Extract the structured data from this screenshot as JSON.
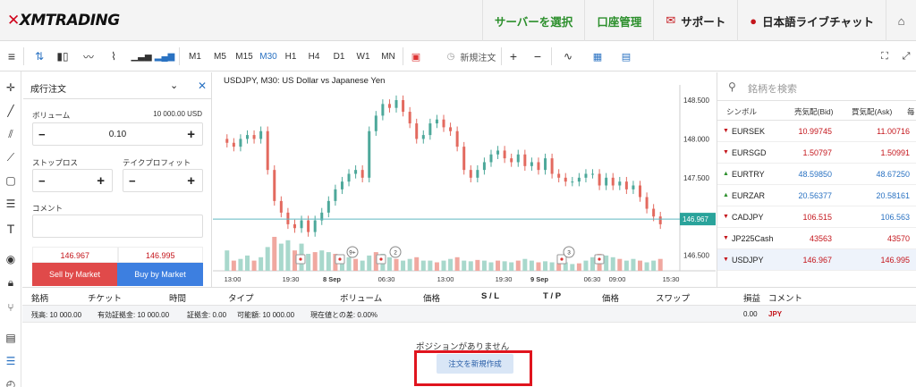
{
  "brand": {
    "logo_text": "XMTRADING",
    "accent": "#c4161c",
    "green": "#2c8f2c",
    "blue": "#2a72c2"
  },
  "topnav": {
    "server_select": "サーバーを選択",
    "account": "口座管理",
    "support": "サポート",
    "live_chat": "日本語ライブチャット"
  },
  "toolbar": {
    "timeframes": [
      "M1",
      "M5",
      "M15",
      "M30",
      "H1",
      "H4",
      "D1",
      "W1",
      "MN"
    ],
    "active_timeframe": "M30",
    "new_order": "新規注文"
  },
  "order_panel": {
    "order_type": "成行注文",
    "volume_label": "ボリューム",
    "volume_hint": "10 000.00 USD",
    "volume_value": "0.10",
    "stoploss_label": "ストップロス",
    "takeprofit_label": "テイクプロフィット",
    "comment_label": "コメント",
    "sell_price": "146.967",
    "buy_price": "146.995",
    "sell_button": "Sell by Market",
    "buy_button": "Buy by Market"
  },
  "chart": {
    "title": "USDJPY, M30: US Dollar vs Japanese Yen",
    "current_price": "146.967"
  },
  "chart_data": {
    "type": "candlestick",
    "title": "USDJPY, M30: US Dollar vs Japanese Yen",
    "y_ticks": [
      "148.500",
      "148.000",
      "147.500",
      "146.500"
    ],
    "x_ticks": [
      "13:00",
      "19:30",
      "8 Sep",
      "06:30",
      "13:00",
      "19:30",
      "9 Sep",
      "06:30",
      "09:00",
      "15:30"
    ],
    "current_price": 146.967,
    "badges": [
      "9+",
      "2",
      "3"
    ],
    "ylim": [
      146.3,
      148.65
    ],
    "close": [
      147.95,
      147.9,
      148.0,
      148.05,
      148.0,
      148.1,
      147.6,
      147.2,
      147.05,
      146.9,
      146.85,
      146.95,
      146.8,
      146.95,
      147.05,
      147.2,
      147.35,
      147.45,
      147.55,
      147.6,
      147.5,
      148.1,
      148.3,
      148.45,
      148.4,
      148.5,
      148.35,
      148.2,
      148.0,
      148.05,
      148.2,
      148.25,
      148.15,
      148.1,
      147.9,
      147.6,
      147.5,
      147.6,
      147.7,
      147.8,
      147.85,
      147.75,
      147.7,
      147.8,
      147.65,
      147.7,
      147.6,
      147.75,
      147.55,
      147.5,
      147.45,
      147.45,
      147.5,
      147.55,
      147.55,
      147.4,
      147.5,
      147.4,
      147.45,
      147.35,
      147.4,
      147.25,
      147.1,
      147.0,
      146.9
    ],
    "volume": [
      0.6,
      0.3,
      0.35,
      0.45,
      0.3,
      0.4,
      0.7,
      1.0,
      0.8,
      0.9,
      0.6,
      0.8,
      0.5,
      0.55,
      0.6,
      0.55,
      0.5,
      0.45,
      0.4,
      0.35,
      0.3,
      0.45,
      0.55,
      0.5,
      0.4,
      0.35,
      0.3,
      0.35,
      0.4,
      0.3,
      0.3,
      0.25,
      0.3,
      0.35,
      0.4,
      0.3,
      0.28,
      0.32,
      0.3,
      0.25,
      0.3,
      0.28,
      0.25,
      0.3,
      0.35,
      0.3,
      0.25,
      0.28,
      0.25,
      0.22,
      0.25,
      0.2,
      0.22,
      0.3,
      0.4,
      0.5,
      0.45,
      0.4,
      0.35,
      0.3,
      0.35,
      0.3,
      0.25,
      0.3,
      0.35
    ]
  },
  "watchlist": {
    "search_placeholder": "銘柄を検索",
    "headers": {
      "symbol": "シンボル",
      "bid": "売気配(Bid)",
      "ask": "買気配(Ask)",
      "extra": "毎"
    },
    "rows": [
      {
        "symbol": "EURSEK",
        "bid": "10.99745",
        "ask": "11.00716",
        "dir": "down"
      },
      {
        "symbol": "EURSGD",
        "bid": "1.50797",
        "ask": "1.50991",
        "dir": "down"
      },
      {
        "symbol": "EURTRY",
        "bid": "48.59850",
        "ask": "48.67250",
        "dir": "up"
      },
      {
        "symbol": "EURZAR",
        "bid": "20.56377",
        "ask": "20.58161",
        "dir": "up"
      },
      {
        "symbol": "CADJPY",
        "bid": "106.515",
        "ask": "106.563",
        "dir": "down"
      },
      {
        "symbol": "JP225Cash",
        "bid": "43563",
        "ask": "43570",
        "dir": "down"
      },
      {
        "symbol": "USDJPY",
        "bid": "146.967",
        "ask": "146.995",
        "dir": "down"
      }
    ]
  },
  "positions": {
    "headers": [
      "銘柄",
      "チケット",
      "時間",
      "タイプ",
      "ボリューム",
      "価格",
      "S / L",
      "T / P",
      "価格",
      "スワップ",
      "損益",
      "コメント"
    ],
    "summary": {
      "balance": "残高: 10 000.00",
      "equity": "有効証拠金: 10 000.00",
      "margin": "証拠金: 0.00",
      "free_margin": "可能額: 10 000.00",
      "margin_level": "現在値との差: 0.00%",
      "profit": "0.00",
      "currency": "JPY"
    },
    "empty_text": "ポジションがありません",
    "new_order_button": "注文を新規作成"
  }
}
